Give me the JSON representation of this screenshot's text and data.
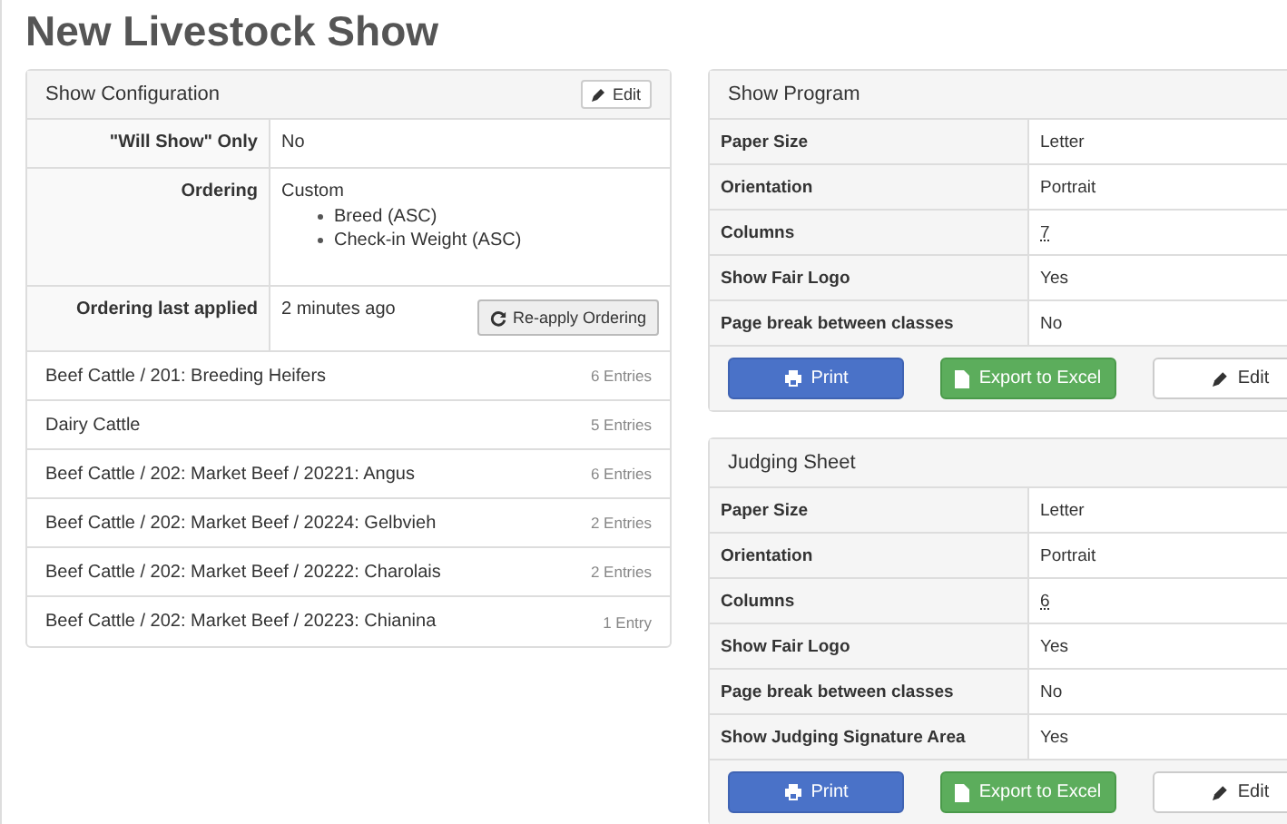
{
  "page": {
    "title": "New Livestock Show"
  },
  "show_configuration": {
    "title": "Show Configuration",
    "edit_button": "Edit",
    "settings": [
      {
        "label": "\"Will Show\" Only",
        "value": "No"
      },
      {
        "label": "Ordering",
        "value": "Custom",
        "list": [
          "Breed (ASC)",
          "Check-in Weight (ASC)"
        ]
      },
      {
        "label": "Ordering last applied",
        "value": "2 minutes ago",
        "button": "Re-apply Ordering"
      }
    ],
    "classes": [
      {
        "name": "Beef Cattle / 201: Breeding Heifers",
        "count": "6 Entries"
      },
      {
        "name": "Dairy Cattle",
        "count": "5 Entries"
      },
      {
        "name": "Beef Cattle / 202: Market Beef / 20221: Angus",
        "count": "6 Entries"
      },
      {
        "name": "Beef Cattle / 202: Market Beef / 20224: Gelbvieh",
        "count": "2 Entries"
      },
      {
        "name": "Beef Cattle / 202: Market Beef / 20222: Charolais",
        "count": "2 Entries"
      },
      {
        "name": "Beef Cattle / 202: Market Beef / 20223: Chianina",
        "count": "1 Entry"
      }
    ]
  },
  "reports": [
    {
      "title": "Show Program",
      "rows": [
        {
          "label": "Paper Size",
          "value": "Letter"
        },
        {
          "label": "Orientation",
          "value": "Portrait"
        },
        {
          "label": "Columns",
          "value": "7",
          "kind": "abbr"
        },
        {
          "label": "Show Fair Logo",
          "value": "Yes"
        },
        {
          "label": "Page break between classes",
          "value": "No"
        }
      ],
      "buttons": [
        {
          "label": "Print",
          "kind": "print"
        },
        {
          "label": "Export to Excel",
          "kind": "export"
        },
        {
          "label": "Edit",
          "kind": "edit"
        }
      ]
    },
    {
      "title": "Judging Sheet",
      "rows": [
        {
          "label": "Paper Size",
          "value": "Letter"
        },
        {
          "label": "Orientation",
          "value": "Portrait"
        },
        {
          "label": "Columns",
          "value": "6",
          "kind": "abbr"
        },
        {
          "label": "Show Fair Logo",
          "value": "Yes"
        },
        {
          "label": "Page break between classes",
          "value": "No"
        },
        {
          "label": "Show Judging Signature Area",
          "value": "Yes"
        }
      ],
      "buttons": [
        {
          "label": "Print",
          "kind": "print"
        },
        {
          "label": "Export to Excel",
          "kind": "export"
        },
        {
          "label": "Edit",
          "kind": "edit"
        }
      ]
    }
  ]
}
